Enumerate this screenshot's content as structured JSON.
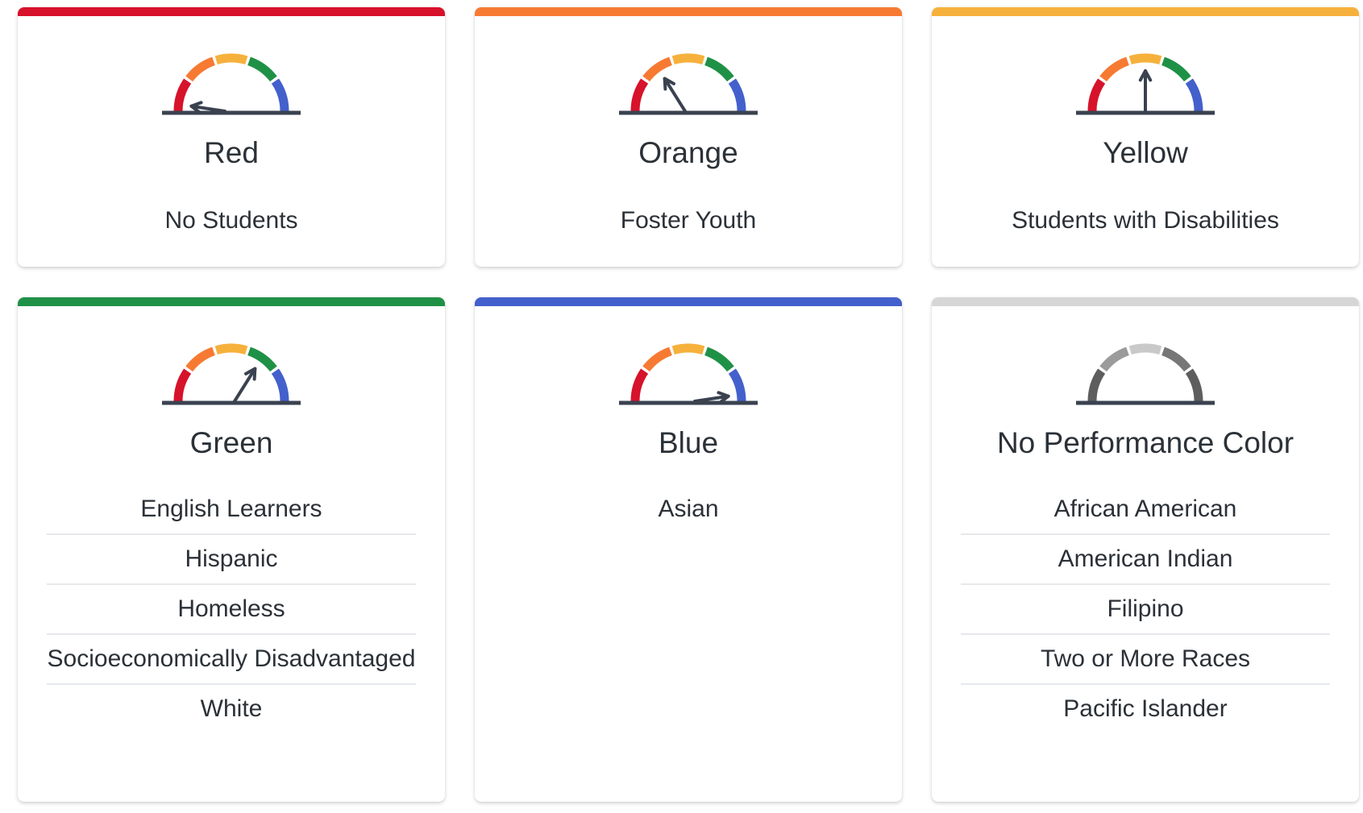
{
  "cards": [
    {
      "level": "Red",
      "bar_color": "#d7122b",
      "needle_percent": 4,
      "gauge_style": "color",
      "groups": [
        "No Students"
      ]
    },
    {
      "level": "Orange",
      "bar_color": "#f77a33",
      "needle_percent": 30,
      "gauge_style": "color",
      "groups": [
        "Foster Youth"
      ]
    },
    {
      "level": "Yellow",
      "bar_color": "#f6b13c",
      "needle_percent": 50,
      "gauge_style": "color",
      "groups": [
        "Students with Disabilities"
      ]
    },
    {
      "level": "Green",
      "bar_color": "#1f9146",
      "needle_percent": 70,
      "gauge_style": "color",
      "groups": [
        "English Learners",
        "Hispanic",
        "Homeless",
        "Socioeconomically Disadvantaged",
        "White"
      ]
    },
    {
      "level": "Blue",
      "bar_color": "#4360cc",
      "needle_percent": 96,
      "gauge_style": "color",
      "groups": [
        "Asian"
      ]
    },
    {
      "level": "No Performance Color",
      "bar_color": "#d6d6d6",
      "needle_percent": null,
      "gauge_style": "gray",
      "groups": [
        "African American",
        "American Indian",
        "Filipino",
        "Two or More Races",
        "Pacific Islander"
      ]
    }
  ],
  "gauge_colors": {
    "segments": [
      "#d7122b",
      "#f77a33",
      "#f6b13c",
      "#1f9146",
      "#4360cc"
    ],
    "gray_segments": [
      "#5e5e5e",
      "#9b9b9b",
      "#c9c9c9",
      "#777777",
      "#5e5e5e"
    ],
    "needle": "#3a4250",
    "base": "#3a4250"
  }
}
